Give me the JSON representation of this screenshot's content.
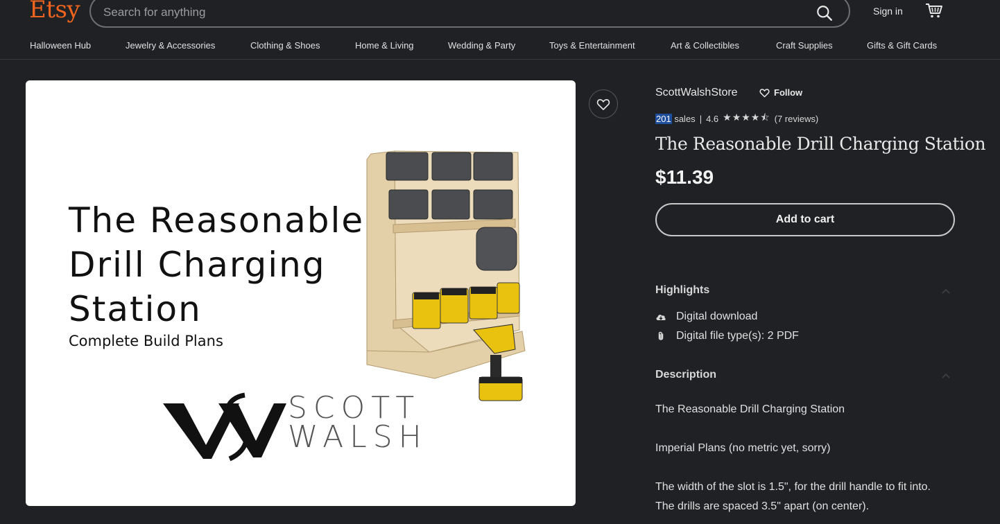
{
  "header": {
    "logo": "Etsy",
    "search_placeholder": "Search for anything",
    "signin": "Sign in"
  },
  "nav": [
    "Halloween Hub",
    "Jewelry & Accessories",
    "Clothing & Shoes",
    "Home & Living",
    "Wedding & Party",
    "Toys & Entertainment",
    "Art & Collectibles",
    "Craft Supplies",
    "Gifts & Gift Cards"
  ],
  "listing_image": {
    "title": "The Reasonable\nDrill Charging\nStation",
    "subtitle": "Complete Build Plans",
    "brand": "SCOTT\nWALSH"
  },
  "shop": {
    "name": "ScottWalshStore",
    "follow": "Follow",
    "sales_count": "201",
    "sales_label": "sales",
    "separator": "|",
    "rating": "4.6",
    "reviews": "(7 reviews)"
  },
  "product": {
    "title": "The Reasonable Drill Charging Station",
    "price": "$11.39",
    "add_to_cart": "Add to cart"
  },
  "highlights": {
    "heading": "Highlights",
    "items": [
      "Digital download",
      "Digital file type(s): 2 PDF"
    ]
  },
  "description": {
    "heading": "Description",
    "lines": [
      "The Reasonable Drill Charging Station",
      "Imperial Plans (no metric yet, sorry)",
      "The width of the slot is 1.5\", for the drill handle to fit into.",
      "The drills are spaced 3.5\" apart (on center)."
    ]
  },
  "colors": {
    "brand": "#f1641e",
    "background": "#1f2124"
  }
}
